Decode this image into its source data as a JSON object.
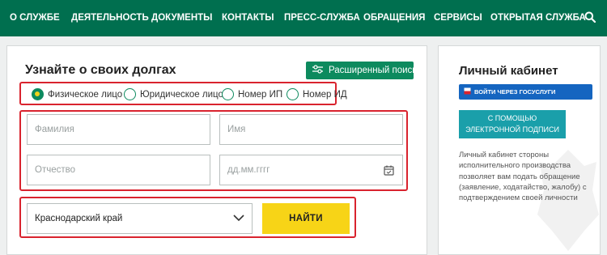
{
  "nav": {
    "items": [
      {
        "label": "О СЛУЖБЕ"
      },
      {
        "label": "ДЕЯТЕЛЬНОСТЬ"
      },
      {
        "label": "ДОКУМЕНТЫ"
      },
      {
        "label": "КОНТАКТЫ"
      },
      {
        "label": "ПРЕСС-СЛУЖБА"
      },
      {
        "label": "ОБРАЩЕНИЯ"
      },
      {
        "label": "СЕРВИСЫ"
      },
      {
        "label": "ОТКРЫТАЯ СЛУЖБА"
      }
    ],
    "search_icon": "search-icon"
  },
  "debt_search": {
    "title": "Узнайте о своих долгах",
    "advanced_label": "Расширенный поиск",
    "radio_options": [
      {
        "label": "Физическое лицо",
        "selected": true
      },
      {
        "label": "Юридическое лицо",
        "selected": false
      },
      {
        "label": "Номер ИП",
        "selected": false
      },
      {
        "label": "Номер ИД",
        "selected": false
      }
    ],
    "fields": {
      "last_name_placeholder": "Фамилия",
      "first_name_placeholder": "Имя",
      "patronymic_placeholder": "Отчество",
      "birth_date_placeholder": "дд.мм.гггг"
    },
    "region_value": "Краснодарский край",
    "find_label": "НАЙТИ"
  },
  "cabinet": {
    "title": "Личный кабинет",
    "gosuslugi_label": "Войти через Госуслуги",
    "signature_label": "С помощью электронной подписи",
    "description": "Личный кабинет стороны исполнительного производства позволяет вам подать обращение (заявление, ходатайство, жалобу) с подтверждением своей личности"
  },
  "colors": {
    "nav_bg": "#006f4f",
    "accent_green": "#0d8a5e",
    "highlight_red": "#d9232e",
    "find_yellow": "#f7d417",
    "gosuslugi_blue": "#1565c0",
    "signature_teal": "#1a9faa"
  }
}
